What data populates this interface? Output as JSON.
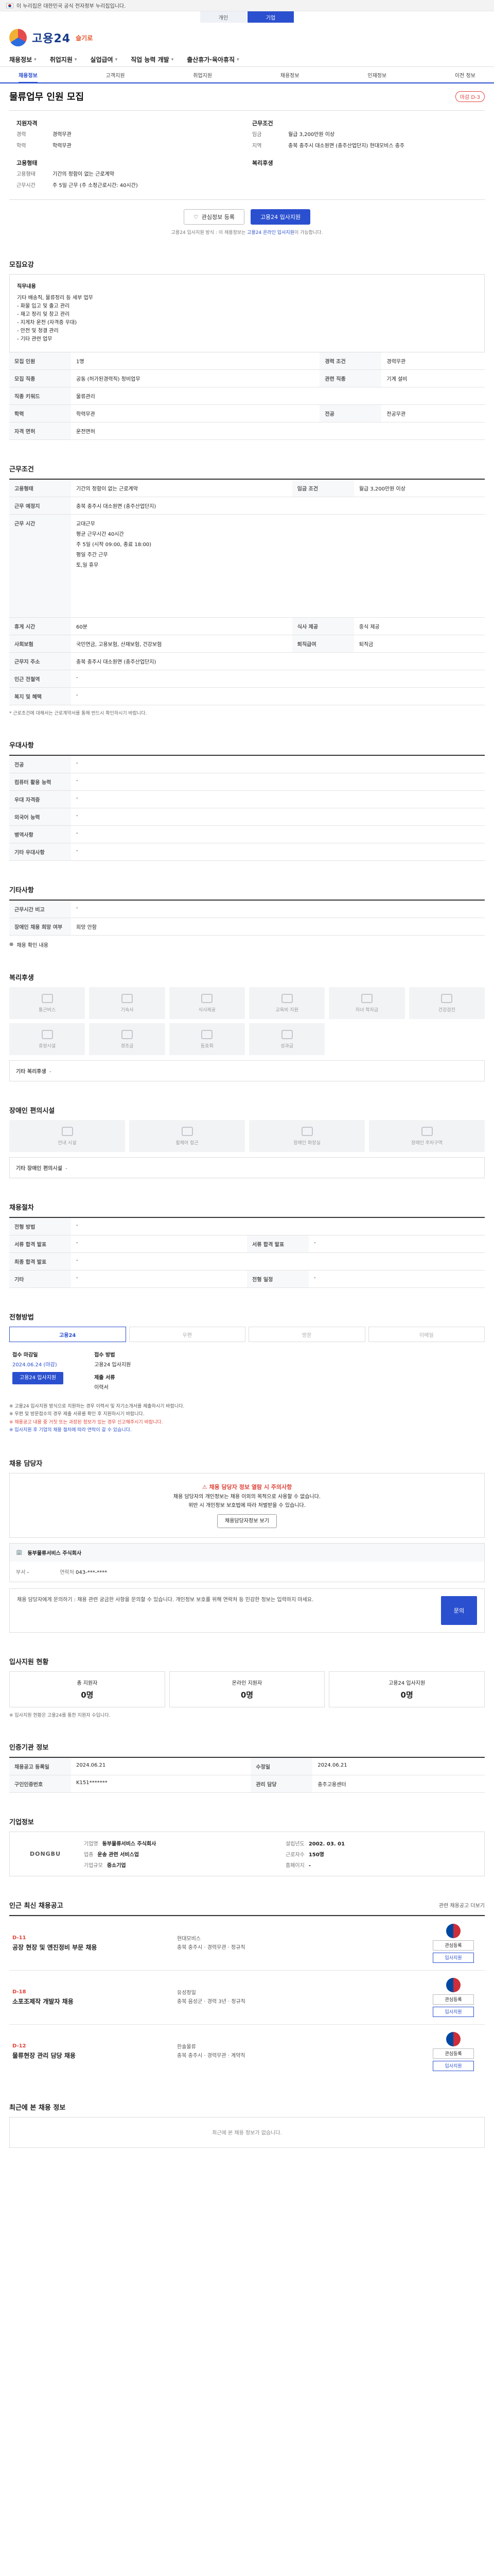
{
  "gov_bar": {
    "text": "이 누리집은 대한민국 공식 전자정부 누리집입니다."
  },
  "util_tabs": [
    {
      "label": "개인",
      "active": false
    },
    {
      "label": "기업",
      "active": true
    }
  ],
  "brand": {
    "name": "고용24",
    "sub": "슬기로"
  },
  "gnb": [
    "채용정보",
    "취업지원",
    "실업급여",
    "직업 능력 개발",
    "출산휴가·육아휴직"
  ],
  "subnav": [
    {
      "label": "채용정보",
      "on": true
    },
    {
      "label": "고객지원"
    },
    {
      "label": "취업지원"
    },
    {
      "label": "채용정보"
    },
    {
      "label": "인재정보"
    },
    {
      "label": "이전 정보"
    }
  ],
  "job": {
    "title": "물류업무 인원 모집",
    "closing_label": "마감 D-3",
    "left_heading": "지원자격",
    "career_label": "경력",
    "career_value": "경력무관",
    "edu_label": "학력",
    "edu_value": "학력무관",
    "right_heading": "근무조건",
    "wage_label": "임금",
    "wage_value": "월급 3,200만원 이상",
    "area_label": "지역",
    "area_value": "충북 충주시 대소원면 (충주산업단지) 현대모비스 충주",
    "type_heading": "고용형태",
    "type_label": "고용형태",
    "type_value": "기간의 정함이 없는 근로계약",
    "hours_label": "근무시간",
    "hours_value": "주 5일 근무 (주 소정근로시간: 40시간)",
    "welfare_heading": "복리후생",
    "btn_scrap": "관심정보 등록",
    "btn_apply": "고용24 입사지원",
    "note_pre": "고용24 입사지원 방식 : 이 채용정보는 ",
    "note_hl": "고용24 온라인 입사지원",
    "note_post": "이 가능합니다."
  },
  "recruit": {
    "title": "모집요강",
    "desc_title": "직무내용",
    "desc_lines": [
      "기타 배송직, 물류정리 등 세부 업무",
      "- 화물 입고 및 출고 관리",
      "- 재고 정리 및 창고 관리",
      "- 지게차 운전 (자격증 우대)",
      "- 안전 및 청결 관리",
      "- 기타 관련 업무"
    ],
    "rows": [
      [
        "모집 인원",
        "1명",
        "경력 조건",
        "경력무관"
      ],
      [
        "모집 직종",
        "공동 (허가된경력직) 정비업무",
        "관련 직종",
        "기계 설비"
      ],
      [
        "직종 키워드",
        "물류관리",
        null,
        null
      ],
      [
        "학력",
        "학력무관",
        "전공",
        "전공무관"
      ],
      [
        "자격 면허",
        "운전면허",
        null,
        null
      ]
    ]
  },
  "condition": {
    "title": "근무조건",
    "rows": [
      [
        "고용형태",
        "기간의 정함이 없는 근로계약",
        "임금 조건",
        "월급 3,200만원 이상"
      ],
      [
        "근무 예정지",
        "충북 충주시 대소원면 (충주산업단지)",
        null,
        null
      ]
    ],
    "hours_label": "근무 시간",
    "hours_lines": [
      "교대근무",
      "평균 근무시간 40시간",
      "주 5일 (시작 09:00, 종료 18:00)",
      "평일 주간 근무",
      "토,일 휴무"
    ],
    "rows2": [
      [
        "휴게 시간",
        "60분",
        "식사 제공",
        "중식 제공"
      ],
      [
        "사회보험",
        "국민연금, 고용보험, 산재보험, 건강보험",
        "퇴직급여",
        "퇴직금"
      ],
      [
        "근무지 주소",
        "충북 충주시 대소원면 (충주산업단지)",
        null,
        null
      ],
      [
        "인근 전철역",
        "-",
        null,
        null
      ],
      [
        "복지 및 혜택",
        "-",
        null,
        null
      ]
    ],
    "footnote": "* 근로조건에 대해서는 근로계약서를 통해 반드시 확인하시기 바랍니다."
  },
  "additional": {
    "title": "우대사항",
    "rows": [
      [
        "전공",
        "-"
      ],
      [
        "컴퓨터 활용 능력",
        "-"
      ],
      [
        "우대 자격증",
        "-"
      ],
      [
        "외국어 능력",
        "-"
      ],
      [
        "병역사항",
        "-"
      ],
      [
        "기타 우대사항",
        "-"
      ]
    ]
  },
  "others": {
    "title": "기타사항",
    "rows": [
      [
        "근무시간 비고",
        "-"
      ],
      [
        "장애인 채용 희망 여부",
        "희망 안함"
      ]
    ],
    "toggle": "채용 확인 내용"
  },
  "welfare": {
    "title": "복리후생",
    "items": [
      "통근버스",
      "기숙사",
      "식사제공",
      "교육비 지원",
      "자녀 학자금",
      "건강검진",
      "휴양시설",
      "경조금",
      "동호회",
      "성과급",
      "",
      ""
    ],
    "etc_title": "기타 복리후생",
    "etc_value": "-"
  },
  "disability": {
    "title": "장애인 편의시설",
    "items": [
      "안내 시설",
      "휠체어 접근",
      "장애인 화장실",
      "장애인 주차구역"
    ],
    "etc_title": "기타 장애인 편의시설",
    "etc_value": "-"
  },
  "process": {
    "title": "채용절차",
    "rows": [
      [
        "전형 방법",
        "-",
        null,
        null
      ],
      [
        "서류 합격 발표",
        "-",
        "서류 합격 발표",
        "-"
      ],
      [
        "최종 합격 발표",
        "-",
        null,
        null
      ],
      [
        "기타",
        "-",
        "전형 일정",
        "-"
      ]
    ]
  },
  "method": {
    "title": "전형방법",
    "tabs": [
      "고용24",
      "우편",
      "방문",
      "이메일"
    ],
    "deadline_label": "접수 마감일",
    "deadline_value": "2024.06.24 (마감)",
    "docs_label": "접수 방법",
    "docs_value": "고용24 입사지원",
    "doc2_label": "제출 서류",
    "doc2_value": "이력서",
    "apply_btn": "고용24 입사지원",
    "bullets": [
      "※ 고용24 입사지원 방식으로 지원하는 경우 이력서 및 자기소개서를 제출하시기 바랍니다.",
      "※ 우편 및 방문접수의 경우 제출 서류를 확인 후 지원하시기 바랍니다.",
      "※ 채용공고 내용 중 거짓 또는 과장된 정보가 있는 경우 신고해주시기 바랍니다.",
      "※ 입사지원 후 기업의 채용 절차에 따라 연락이 갈 수 있습니다."
    ]
  },
  "contact": {
    "title": "채용 담당자",
    "warn": "채용 담당자 정보 열람 시 주의사항",
    "text": "채용 담당자의 개인정보는 채용 이외의 목적으로 사용할 수 없습니다.",
    "text2": "위반 시 개인정보 보호법에 따라 처벌받을 수 있습니다.",
    "reveal_btn": "채용담당자정보 보기",
    "company_name": "동부물류서비스 주식회사",
    "dept_label": "부서",
    "dept_value": "-",
    "phone_label": "연락처",
    "phone_value": "043-***-****",
    "qna_text": "채용 담당자에게 문의하기 : 채용 관련 궁금한 사항을 문의할 수 있습니다. 개인정보 보호를 위해 연락처 등 민감한 정보는 입력하지 마세요.",
    "qna_btn": "문의"
  },
  "applicants": {
    "title": "입사지원 현황",
    "stats": [
      {
        "label": "총 지원자",
        "value": "0명"
      },
      {
        "label": "온라인 지원자",
        "value": "0명"
      },
      {
        "label": "고용24 입사지원",
        "value": "0명"
      }
    ],
    "note": "※ 입사지원 현황은 고용24를 통한 지원자 수입니다."
  },
  "reginfo": {
    "title": "인증기관 정보",
    "rows": [
      [
        "채용공고 등록일",
        "2024.06.21",
        "수정일",
        "2024.06.21"
      ],
      [
        "구인인증번호",
        "K151*******",
        "관리 담당",
        "충주고용센터"
      ]
    ]
  },
  "company": {
    "title": "기업정보",
    "logo": "DONGBU",
    "fields": [
      [
        "기업명",
        "동부물류서비스 주식회사"
      ],
      [
        "설립년도",
        "2002. 03. 01"
      ],
      [
        "업종",
        "운송 관련 서비스업"
      ],
      [
        "근로자수",
        "150명"
      ],
      [
        "기업규모",
        "중소기업"
      ],
      [
        "홈페이지",
        "-"
      ]
    ]
  },
  "similar": {
    "title": "인근 최신 채용공고",
    "more": "관련 채용공고 더보기",
    "jobs": [
      {
        "dday": "D-11",
        "title": "공장 현장 및 엔진정비 부문 채용",
        "company": "현대모비스",
        "meta": "충북 충주시 · 경력무관 · 정규직",
        "btn1": "관심등록",
        "btn2": "입사지원"
      },
      {
        "dday": "D-18",
        "title": "소포조제작 개발자 채용",
        "company": "유성정밀",
        "meta": "충북 음성군 · 경력 3년 · 정규직",
        "btn1": "관심등록",
        "btn2": "입사지원"
      },
      {
        "dday": "D-12",
        "title": "물류현장 관리 담당 채용",
        "company": "한솔물류",
        "meta": "충북 충주시 · 경력무관 · 계약직",
        "btn1": "관심등록",
        "btn2": "입사지원"
      }
    ]
  },
  "recent": {
    "title": "최근에 본 채용 정보",
    "empty": "최근에 본 채용 정보가 없습니다."
  }
}
